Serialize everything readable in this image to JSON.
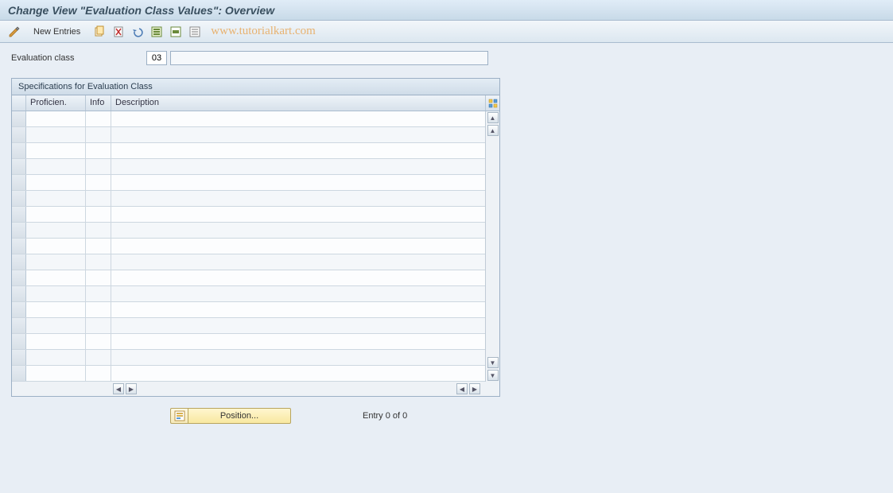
{
  "title": "Change View \"Evaluation Class Values\": Overview",
  "toolbar": {
    "new_entries": "New Entries",
    "watermark": "www.tutorialkart.com"
  },
  "field": {
    "label": "Evaluation class",
    "code": "03",
    "desc": ""
  },
  "group": {
    "title": "Specifications for Evaluation Class",
    "cols": {
      "prof": "Proficien.",
      "info": "Info",
      "desc": "Description"
    },
    "rows": [
      {
        "prof": "",
        "info": "",
        "desc": ""
      },
      {
        "prof": "",
        "info": "",
        "desc": ""
      },
      {
        "prof": "",
        "info": "",
        "desc": ""
      },
      {
        "prof": "",
        "info": "",
        "desc": ""
      },
      {
        "prof": "",
        "info": "",
        "desc": ""
      },
      {
        "prof": "",
        "info": "",
        "desc": ""
      },
      {
        "prof": "",
        "info": "",
        "desc": ""
      },
      {
        "prof": "",
        "info": "",
        "desc": ""
      },
      {
        "prof": "",
        "info": "",
        "desc": ""
      },
      {
        "prof": "",
        "info": "",
        "desc": ""
      },
      {
        "prof": "",
        "info": "",
        "desc": ""
      },
      {
        "prof": "",
        "info": "",
        "desc": ""
      },
      {
        "prof": "",
        "info": "",
        "desc": ""
      },
      {
        "prof": "",
        "info": "",
        "desc": ""
      },
      {
        "prof": "",
        "info": "",
        "desc": ""
      },
      {
        "prof": "",
        "info": "",
        "desc": ""
      },
      {
        "prof": "",
        "info": "",
        "desc": ""
      }
    ]
  },
  "footer": {
    "position": "Position...",
    "entry": "Entry 0 of 0"
  }
}
